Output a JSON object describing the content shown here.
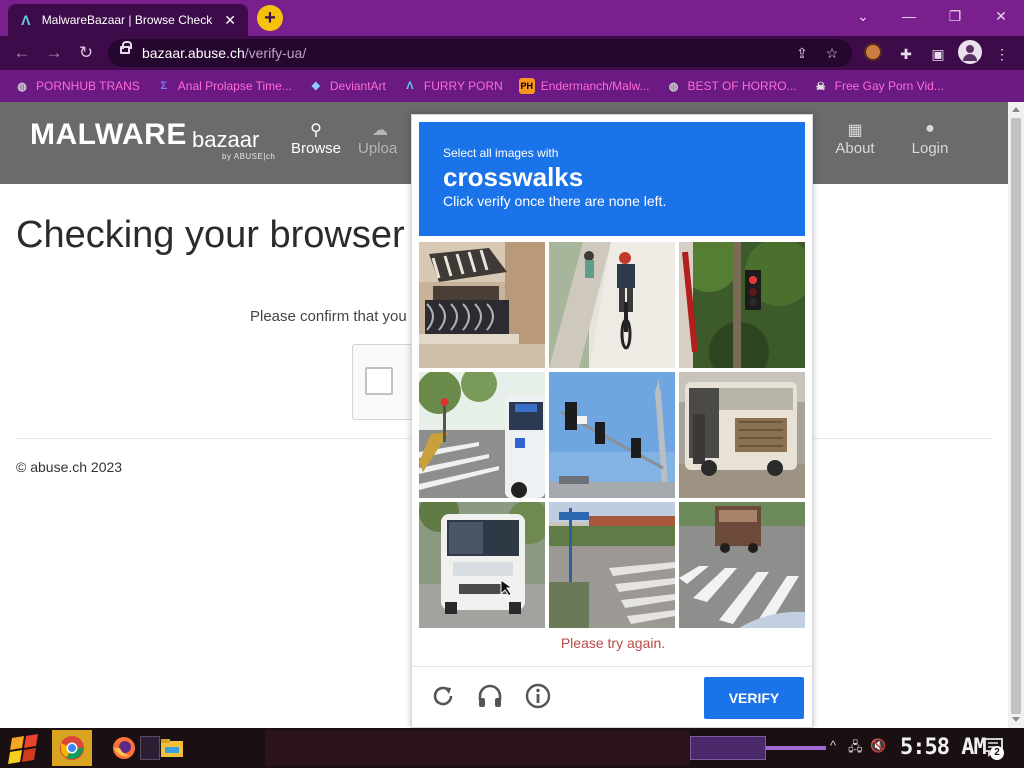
{
  "browser": {
    "tab_title": "MalwareBazaar | Browse Check",
    "tab_close": "✕",
    "new_tab": "+",
    "url_host": "bazaar.abuse.ch",
    "url_path": "/verify-ua/",
    "window_controls": [
      "⌄",
      "—",
      "❐",
      "✕"
    ],
    "accent": "#7a1f8e"
  },
  "bookmarks": [
    {
      "label": "PORNHUB TRANS",
      "icon": "globe-icon"
    },
    {
      "label": "Anal Prolapse Time...",
      "icon": "sigma-icon"
    },
    {
      "label": "DeviantArt",
      "icon": "deviantart-icon"
    },
    {
      "label": "FURRY PORN",
      "icon": "lambda-icon"
    },
    {
      "label": "Endermanch/Malw...",
      "icon": "ph-icon"
    },
    {
      "label": "BEST OF HORRO...",
      "icon": "globe-icon"
    },
    {
      "label": "Free Gay Porn Vid...",
      "icon": "skull-icon"
    }
  ],
  "site": {
    "logo_main": "MALWARE",
    "logo_sub": "bazaar",
    "logo_by": "by ABUSE|ch",
    "nav": [
      {
        "label": "Browse",
        "icon": "search-icon"
      },
      {
        "label": "Uploa",
        "icon": "upload-icon"
      },
      {
        "label": "About",
        "icon": "building-icon"
      },
      {
        "label": "Login",
        "icon": "user-icon"
      }
    ],
    "heading": "Checking your browser",
    "confirm": "Please confirm that you",
    "footer": "© abuse.ch 2023"
  },
  "captcha": {
    "prompt_line1": "Select all images with",
    "prompt_keyword": "crosswalks",
    "prompt_line2": "Click verify once there are none left.",
    "error": "Please try again.",
    "verify_label": "VERIFY",
    "accent": "#1a73e8",
    "tiles": [
      "balcony",
      "cyclist-path",
      "traffic-light-red",
      "bus-crosswalk",
      "traffic-lights-sky",
      "old-bus",
      "bus-front",
      "street-crosswalk",
      "truck-crosswalk"
    ]
  },
  "taskbar": {
    "clock": "5:58 AM",
    "notification_count": "2"
  }
}
